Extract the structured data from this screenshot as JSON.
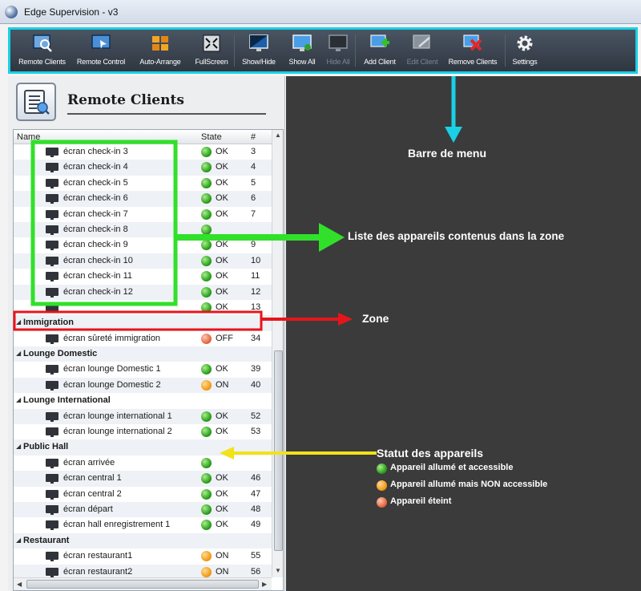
{
  "window": {
    "title": "Edge Supervision - v3"
  },
  "toolbar": {
    "buttons": [
      {
        "label": "Remote Clients",
        "icon": "remote-clients-icon",
        "enabled": true
      },
      {
        "label": "Remote Control",
        "icon": "remote-control-icon",
        "enabled": true
      },
      {
        "label": "Auto-Arrange",
        "icon": "auto-arrange-icon",
        "enabled": true
      },
      {
        "label": "FullScreen",
        "icon": "fullscreen-icon",
        "enabled": true
      },
      {
        "label": "Show/Hide",
        "icon": "show-hide-icon",
        "enabled": true
      },
      {
        "label": "Show All",
        "icon": "show-all-icon",
        "enabled": true
      },
      {
        "label": "Hide All",
        "icon": "hide-all-icon",
        "enabled": false
      },
      {
        "label": "Add Client",
        "icon": "add-client-icon",
        "enabled": true
      },
      {
        "label": "Edit Client",
        "icon": "edit-client-icon",
        "enabled": false
      },
      {
        "label": "Remove Clients",
        "icon": "remove-clients-icon",
        "enabled": true
      },
      {
        "label": "Settings",
        "icon": "gear-icon",
        "enabled": true
      }
    ]
  },
  "panel": {
    "title": "Remote Clients",
    "columns": {
      "name": "Name",
      "state": "State",
      "num": "#"
    }
  },
  "list": [
    {
      "type": "client",
      "name": "écran check-in 3",
      "status": "green",
      "state": "OK",
      "num": "3"
    },
    {
      "type": "client",
      "name": "écran check-in 4",
      "status": "green",
      "state": "OK",
      "num": "4"
    },
    {
      "type": "client",
      "name": "écran check-in 5",
      "status": "green",
      "state": "OK",
      "num": "5"
    },
    {
      "type": "client",
      "name": "écran check-in 6",
      "status": "green",
      "state": "OK",
      "num": "6"
    },
    {
      "type": "client",
      "name": "écran check-in 7",
      "status": "green",
      "state": "OK",
      "num": "7"
    },
    {
      "type": "client",
      "name": "écran check-in 8",
      "status": "green",
      "state": "",
      "num": ""
    },
    {
      "type": "client",
      "name": "écran check-in 9",
      "status": "green",
      "state": "OK",
      "num": "9"
    },
    {
      "type": "client",
      "name": "écran check-in 10",
      "status": "green",
      "state": "OK",
      "num": "10"
    },
    {
      "type": "client",
      "name": "écran check-in 11",
      "status": "green",
      "state": "OK",
      "num": "11"
    },
    {
      "type": "client",
      "name": "écran check-in 12",
      "status": "green",
      "state": "OK",
      "num": "12"
    },
    {
      "type": "client",
      "name": "",
      "status": "green",
      "state": "OK",
      "num": "13"
    },
    {
      "type": "group",
      "name": "Immigration"
    },
    {
      "type": "client",
      "name": "écran sûreté immigration",
      "status": "red",
      "state": "OFF",
      "num": "34"
    },
    {
      "type": "group",
      "name": "Lounge Domestic"
    },
    {
      "type": "client",
      "name": "écran lounge Domestic 1",
      "status": "green",
      "state": "OK",
      "num": "39"
    },
    {
      "type": "client",
      "name": "écran lounge Domestic 2",
      "status": "orange",
      "state": "ON",
      "num": "40"
    },
    {
      "type": "group",
      "name": "Lounge International"
    },
    {
      "type": "client",
      "name": "écran lounge international 1",
      "status": "green",
      "state": "OK",
      "num": "52"
    },
    {
      "type": "client",
      "name": "écran lounge international 2",
      "status": "green",
      "state": "OK",
      "num": "53"
    },
    {
      "type": "group",
      "name": "Public Hall"
    },
    {
      "type": "client",
      "name": "écran arrivée",
      "status": "green",
      "state": "",
      "num": ""
    },
    {
      "type": "client",
      "name": "écran central 1",
      "status": "green",
      "state": "OK",
      "num": "46"
    },
    {
      "type": "client",
      "name": "écran central 2",
      "status": "green",
      "state": "OK",
      "num": "47"
    },
    {
      "type": "client",
      "name": "écran départ",
      "status": "green",
      "state": "OK",
      "num": "48"
    },
    {
      "type": "client",
      "name": "écran hall enregistrement 1",
      "status": "green",
      "state": "OK",
      "num": "49"
    },
    {
      "type": "group",
      "name": "Restaurant"
    },
    {
      "type": "client",
      "name": "écran restaurant1",
      "status": "orange",
      "state": "ON",
      "num": "55"
    },
    {
      "type": "client",
      "name": "écran restaurant2",
      "status": "orange",
      "state": "ON",
      "num": "56"
    }
  ],
  "annotations": {
    "menu_bar": "Barre de menu",
    "device_list": "Liste des appareils contenus dans la zone",
    "zone": "Zone",
    "status_title": "Statut des appareils",
    "legend": [
      {
        "status": "green",
        "text": "Appareil allumé et accessible"
      },
      {
        "status": "orange",
        "text": "Appareil allumé mais NON accessible"
      },
      {
        "status": "red",
        "text": "Appareil éteint"
      }
    ]
  },
  "colors": {
    "highlight_toolbar": "#19d0e6",
    "highlight_list": "#31e02a",
    "highlight_zone": "#e8141b",
    "highlight_status": "#f2e21a",
    "dark_panel": "#3b3b3b"
  }
}
